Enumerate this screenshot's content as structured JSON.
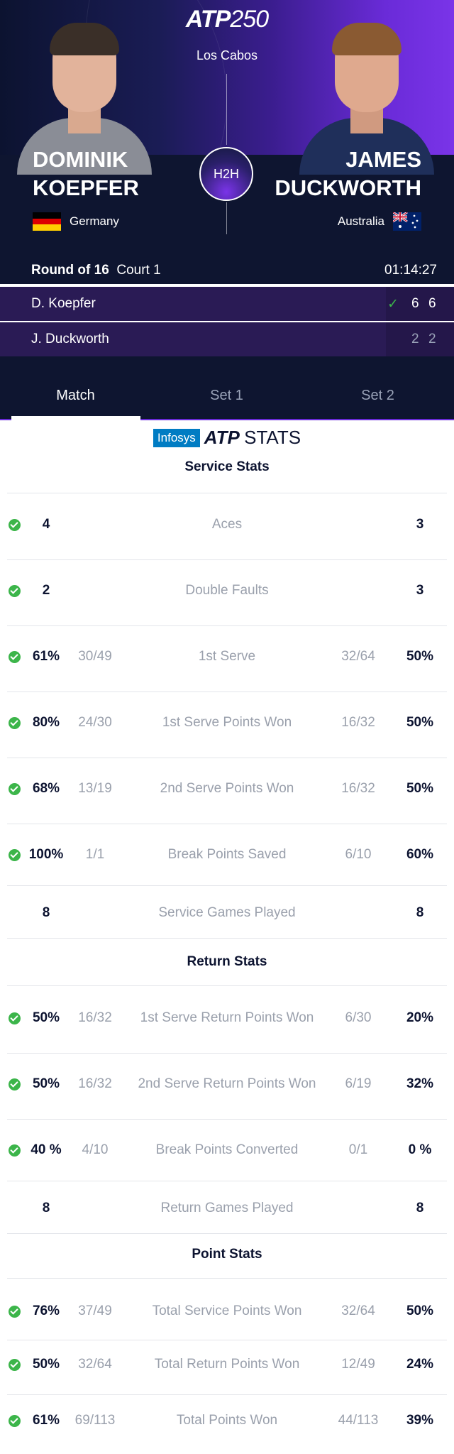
{
  "header": {
    "tournament_logo": "ATP",
    "tournament_level": "250",
    "location": "Los Cabos",
    "h2h_label": "H2H",
    "round": "Round of 16",
    "court": "Court 1",
    "duration": "01:14:27"
  },
  "players": {
    "p1": {
      "first": "DOMINIK",
      "last": "KOEPFER",
      "country": "Germany",
      "short": "D. Koepfer",
      "set1": "6",
      "set2": "6",
      "winner": true
    },
    "p2": {
      "first": "JAMES",
      "last": "DUCKWORTH",
      "country": "Australia",
      "short": "J. Duckworth",
      "set1": "2",
      "set2": "2",
      "winner": false
    }
  },
  "tabs": [
    "Match",
    "Set 1",
    "Set 2"
  ],
  "stats_logo": {
    "sponsor": "Infosys",
    "brand": "ATP",
    "suffix": "STATS"
  },
  "sections": {
    "service": "Service Stats",
    "return": "Return Stats",
    "point": "Point Stats"
  },
  "service_stats": [
    {
      "label": "Aces",
      "p1": "4",
      "p1_frac": "",
      "p2": "3",
      "p2_frac": "",
      "check": true
    },
    {
      "label": "Double Faults",
      "p1": "2",
      "p1_frac": "",
      "p2": "3",
      "p2_frac": "",
      "check": true
    },
    {
      "label": "1st Serve",
      "p1": "61%",
      "p1_frac": "30/49",
      "p2": "50%",
      "p2_frac": "32/64",
      "check": true
    },
    {
      "label": "1st Serve Points Won",
      "p1": "80%",
      "p1_frac": "24/30",
      "p2": "50%",
      "p2_frac": "16/32",
      "check": true
    },
    {
      "label": "2nd Serve Points Won",
      "p1": "68%",
      "p1_frac": "13/19",
      "p2": "50%",
      "p2_frac": "16/32",
      "check": true
    },
    {
      "label": "Break Points Saved",
      "p1": "100%",
      "p1_frac": "1/1",
      "p2": "60%",
      "p2_frac": "6/10",
      "check": true
    },
    {
      "label": "Service Games Played",
      "p1": "8",
      "p1_frac": "",
      "p2": "8",
      "p2_frac": "",
      "check": false
    }
  ],
  "return_stats": [
    {
      "label": "1st Serve Return Points Won",
      "p1": "50%",
      "p1_frac": "16/32",
      "p2": "20%",
      "p2_frac": "6/30",
      "check": true
    },
    {
      "label": "2nd Serve Return Points Won",
      "p1": "50%",
      "p1_frac": "16/32",
      "p2": "32%",
      "p2_frac": "6/19",
      "check": true
    },
    {
      "label": "Break Points Converted",
      "p1": "40 %",
      "p1_frac": "4/10",
      "p2": "0 %",
      "p2_frac": "0/1",
      "check": true
    },
    {
      "label": "Return Games Played",
      "p1": "8",
      "p1_frac": "",
      "p2": "8",
      "p2_frac": "",
      "check": false
    }
  ],
  "point_stats": [
    {
      "label": "Total Service Points Won",
      "p1": "76%",
      "p1_frac": "37/49",
      "p2": "50%",
      "p2_frac": "32/64",
      "check": true
    },
    {
      "label": "Total Return Points Won",
      "p1": "50%",
      "p1_frac": "32/64",
      "p2": "24%",
      "p2_frac": "12/49",
      "check": true
    },
    {
      "label": "Total Points Won",
      "p1": "61%",
      "p1_frac": "69/113",
      "p2": "39%",
      "p2_frac": "44/113",
      "check": true
    }
  ],
  "colors": {
    "accent_purple": "#6a2bd8",
    "navy": "#0e1530",
    "win_green": "#3cb54a"
  }
}
